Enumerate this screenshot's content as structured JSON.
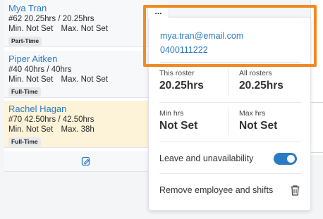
{
  "employees": [
    {
      "name": "Mya Tran",
      "summary": "#62 20.25hrs / 20.25hrs",
      "min": "Min. Not Set",
      "max": "Max. Not Set",
      "badge": "Part-Time"
    },
    {
      "name": "Piper Aitken",
      "summary": "#40 40hrs / 40hrs",
      "min": "Min. Not Set",
      "max": "Max. Not Set",
      "badge": "Full-Time"
    },
    {
      "name": "Rachel Hagan",
      "summary": "#70 42.50hrs / 42.50hrs",
      "min": "Min. Not Set",
      "max": "Max. 38h",
      "badge": "Full-Time"
    }
  ],
  "popover": {
    "more_label": "...",
    "email": "mya.tran@email.com",
    "phone": "0400111222",
    "this_roster_label": "This roster",
    "this_roster_value": "20.25hrs",
    "all_rosters_label": "All rosters",
    "all_rosters_value": "20.25hrs",
    "min_hrs_label": "Min hrs",
    "min_hrs_value": "Not Set",
    "max_hrs_label": "Max hrs",
    "max_hrs_value": "Not Set",
    "leave_label": "Leave and unavailability",
    "leave_enabled": true,
    "remove_label": "Remove employee and shifts"
  },
  "colors": {
    "accent": "#2b7bc4",
    "highlight": "#f08a24",
    "selected_row": "#fdf3d8"
  },
  "icons": [
    "edit-icon",
    "more-icon",
    "trash-icon"
  ]
}
